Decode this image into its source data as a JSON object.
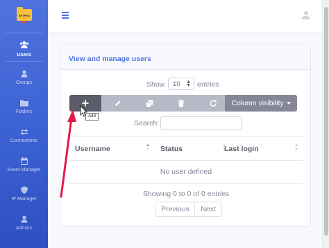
{
  "app": {
    "logo_text": "SFTPGo"
  },
  "sidebar": {
    "items": [
      {
        "label": "Users",
        "icon": "users-icon",
        "active": true
      },
      {
        "label": "Groups",
        "icon": "groups-icon"
      },
      {
        "label": "Folders",
        "icon": "folder-icon"
      },
      {
        "label": "Connections",
        "icon": "exchange-icon"
      },
      {
        "label": "Event Manager",
        "icon": "calendar-icon"
      },
      {
        "label": "IP Manager",
        "icon": "shield-icon"
      },
      {
        "label": "Admins",
        "icon": "admin-icon"
      }
    ]
  },
  "card": {
    "title": "View and manage users"
  },
  "length": {
    "show": "Show",
    "value": "10",
    "entries": "entries"
  },
  "toolbar": {
    "add_tooltip": "Add",
    "column_visibility": "Column visibility"
  },
  "search": {
    "label": "Search:",
    "value": ""
  },
  "table": {
    "columns": [
      "Username",
      "Status",
      "Last login"
    ],
    "empty": "No user defined"
  },
  "info": "Showing 0 to 0 of 0 entries",
  "pagination": {
    "previous": "Previous",
    "next": "Next"
  },
  "colors": {
    "primary": "#4e73df",
    "arrow": "#e8174a"
  }
}
